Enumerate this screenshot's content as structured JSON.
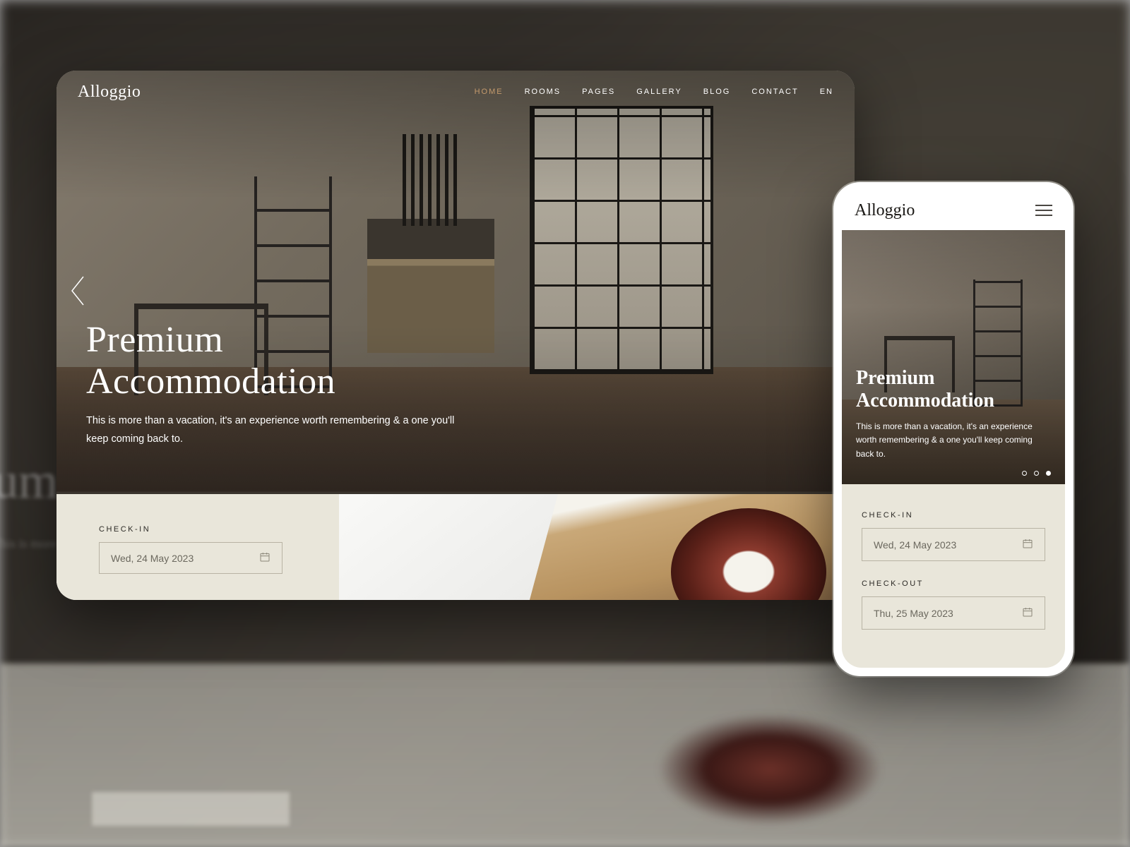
{
  "brand": "Alloggio",
  "nav": {
    "items": [
      {
        "label": "HOME",
        "active": true
      },
      {
        "label": "ROOMS",
        "active": false
      },
      {
        "label": "PAGES",
        "active": false
      },
      {
        "label": "GALLERY",
        "active": false
      },
      {
        "label": "BLOG",
        "active": false
      },
      {
        "label": "CONTACT",
        "active": false
      },
      {
        "label": "EN",
        "active": false
      }
    ]
  },
  "hero": {
    "title": "Premium Accommodation",
    "subtitle": "This is more than a vacation, it's an experience worth remembering & a one you'll keep coming back to."
  },
  "booking": {
    "checkin_label": "CHECK-IN",
    "checkin_value": "Wed, 24 May 2023",
    "checkout_label": "CHECK-OUT",
    "checkout_value": "Thu, 25 May 2023"
  },
  "mobile": {
    "hero": {
      "title": "Premium Accommodation",
      "subtitle": "This is more than a vacation, it's an experience worth remembering & a one you'll keep coming back to."
    },
    "slider": {
      "dot_count": 3,
      "active_index": 2
    }
  },
  "bg": {
    "title_frag": "um",
    "sub_frag": "This is more than a vacation, it's an"
  }
}
